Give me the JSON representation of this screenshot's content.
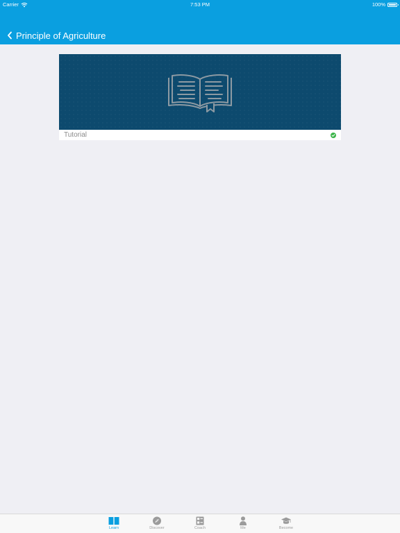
{
  "status": {
    "carrier": "Carrier",
    "time": "7:53 PM",
    "battery": "100%"
  },
  "nav": {
    "title": "Principle of Agriculture"
  },
  "card": {
    "label": "Tutorial",
    "completed": true,
    "banner_icon": "book-icon"
  },
  "tabbar": {
    "tabs": [
      {
        "label": "Learn",
        "icon": "book-tab-icon",
        "active": true
      },
      {
        "label": "Discover",
        "icon": "compass-icon",
        "active": false
      },
      {
        "label": "Coach",
        "icon": "coach-icon",
        "active": false
      },
      {
        "label": "Me",
        "icon": "person-icon",
        "active": false
      },
      {
        "label": "Become",
        "icon": "graduation-cap-icon",
        "active": false
      }
    ]
  },
  "colors": {
    "accent": "#0a9fe0",
    "banner": "#0d4a6e",
    "background": "#efeff4",
    "success": "#3cb54a"
  }
}
